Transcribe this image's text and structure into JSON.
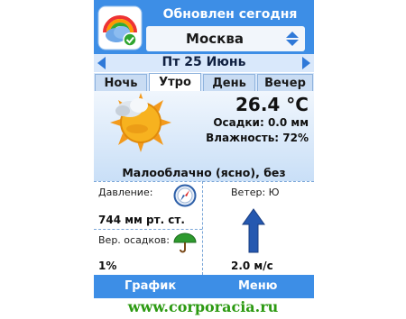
{
  "header": {
    "updated_label": "Обновлен сегодня",
    "city": "Москва",
    "logo_icon": "weather-app-logo-icon",
    "city_selector_icon": "up-down-arrows-icon"
  },
  "date_nav": {
    "date": "Пт 25 Июнь",
    "prev_icon": "arrow-left-icon",
    "next_icon": "arrow-right-icon"
  },
  "tabs": [
    {
      "label": "Ночь",
      "active": false
    },
    {
      "label": "Утро",
      "active": true
    },
    {
      "label": "День",
      "active": false
    },
    {
      "label": "Вечер",
      "active": false
    }
  ],
  "current": {
    "icon": "partly-cloudy-sun-icon",
    "temperature": "26.4 °C",
    "precipitation": "Осадки: 0.0 мм",
    "humidity": "Влажность: 72%",
    "description": "Малооблачно (ясно), без осадков"
  },
  "details": {
    "pressure_label": "Давление:",
    "pressure_value": "744 мм рт. ст.",
    "pressure_icon": "compass-icon",
    "precip_chance_label": "Вер. осадков:",
    "precip_chance_value": "1%",
    "precip_chance_icon": "umbrella-icon",
    "wind_label": "Ветер: Ю",
    "wind_value": "2.0 м/с",
    "wind_icon": "wind-arrow-up-icon"
  },
  "softkeys": {
    "left": "График",
    "right": "Меню"
  },
  "watermark": "www.corporacia.ru",
  "colors": {
    "brand_blue": "#3d8ee6",
    "watermark_green": "#2c9a12"
  }
}
